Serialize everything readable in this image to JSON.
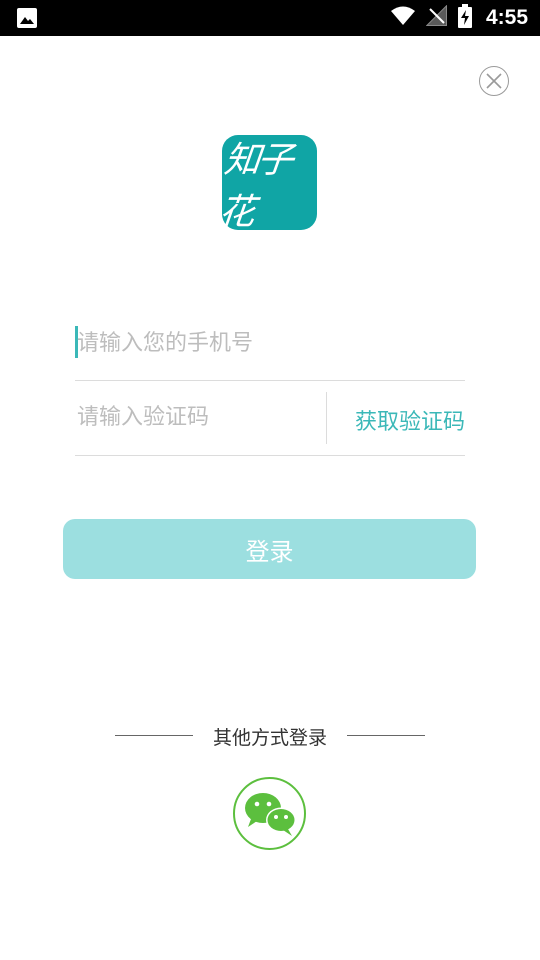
{
  "status_bar": {
    "time": "4:55",
    "icons": [
      "image-icon",
      "wifi-icon",
      "no-signal-icon",
      "battery-charging-icon"
    ]
  },
  "close": {
    "icon": "close-icon"
  },
  "logo": {
    "text": "知子花"
  },
  "form": {
    "phone_placeholder": "请输入您的手机号",
    "code_placeholder": "请输入验证码",
    "get_code_label": "获取验证码"
  },
  "login_button": {
    "label": "登录"
  },
  "other_login": {
    "label": "其他方式登录",
    "wechat_icon": "wechat-icon"
  },
  "colors": {
    "accent": "#3bb8b8",
    "logo_bg": "#10a5a5",
    "login_bg": "#9cdfe0",
    "wechat": "#5cbf3e"
  }
}
